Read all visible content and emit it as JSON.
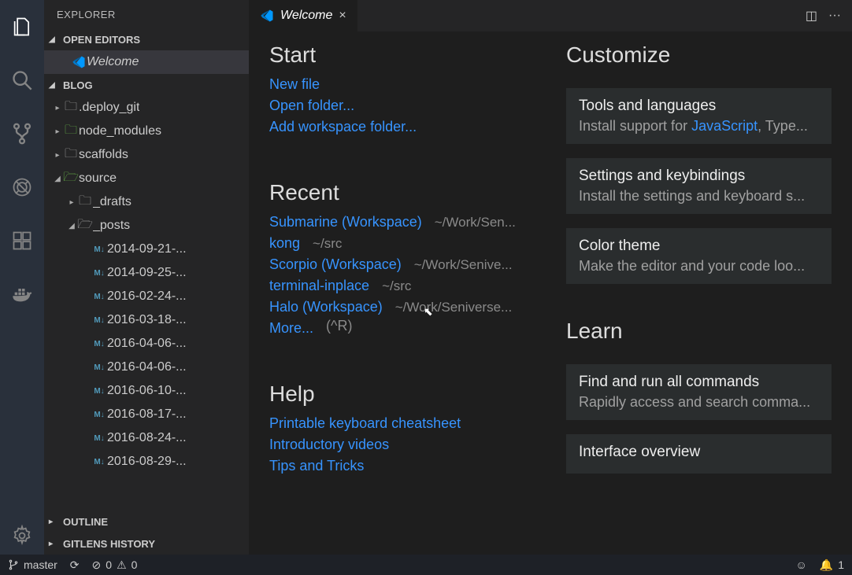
{
  "sidebar": {
    "title": "EXPLORER",
    "sections": {
      "openEditors": {
        "label": "OPEN EDITORS",
        "item": "Welcome"
      },
      "workspace": {
        "label": "BLOG",
        "folders": [
          {
            "name": ".deploy_git",
            "expanded": false,
            "green": false
          },
          {
            "name": "node_modules",
            "expanded": false,
            "green": true
          },
          {
            "name": "scaffolds",
            "expanded": false,
            "green": false
          },
          {
            "name": "source",
            "expanded": true,
            "green": true
          }
        ],
        "sourceChildren": [
          {
            "name": "_drafts",
            "expanded": false
          },
          {
            "name": "_posts",
            "expanded": true
          }
        ],
        "postsFiles": [
          "2014-09-21-...",
          "2014-09-25-...",
          "2016-02-24-...",
          "2016-03-18-...",
          "2016-04-06-...",
          "2016-04-06-...",
          "2016-06-10-...",
          "2016-08-17-...",
          "2016-08-24-...",
          "2016-08-29-..."
        ]
      },
      "outline": {
        "label": "OUTLINE"
      },
      "gitlens": {
        "label": "GITLENS HISTORY"
      }
    }
  },
  "tab": {
    "title": "Welcome",
    "close": "×"
  },
  "tabActions": {
    "split": "◫",
    "more": "···"
  },
  "welcome": {
    "start": {
      "heading": "Start",
      "links": [
        "New file",
        "Open folder...",
        "Add workspace folder..."
      ]
    },
    "recent": {
      "heading": "Recent",
      "items": [
        {
          "name": "Submarine (Workspace)",
          "path": "~/Work/Sen..."
        },
        {
          "name": "kong",
          "path": "~/src"
        },
        {
          "name": "Scorpio (Workspace)",
          "path": "~/Work/Senive..."
        },
        {
          "name": "terminal-inplace",
          "path": "~/src"
        },
        {
          "name": "Halo (Workspace)",
          "path": "~/Work/Seniverse..."
        }
      ],
      "more": "More...",
      "moreHint": "(^R)"
    },
    "help": {
      "heading": "Help",
      "links": [
        "Printable keyboard cheatsheet",
        "Introductory videos",
        "Tips and Tricks"
      ]
    },
    "customize": {
      "heading": "Customize",
      "cards": [
        {
          "title": "Tools and languages",
          "desc_pre": "Install support for ",
          "desc_hl": "JavaScript",
          "desc_post": ", Type..."
        },
        {
          "title": "Settings and keybindings",
          "desc": "Install the settings and keyboard s..."
        },
        {
          "title": "Color theme",
          "desc": "Make the editor and your code loo..."
        }
      ]
    },
    "learn": {
      "heading": "Learn",
      "cards": [
        {
          "title": "Find and run all commands",
          "desc": "Rapidly access and search comma..."
        },
        {
          "title": "Interface overview",
          "desc": ""
        }
      ]
    }
  },
  "statusbar": {
    "branch": "master",
    "sync": "⟳",
    "errors": "0",
    "warnings": "0",
    "smile": "☺",
    "bellCount": "1"
  }
}
